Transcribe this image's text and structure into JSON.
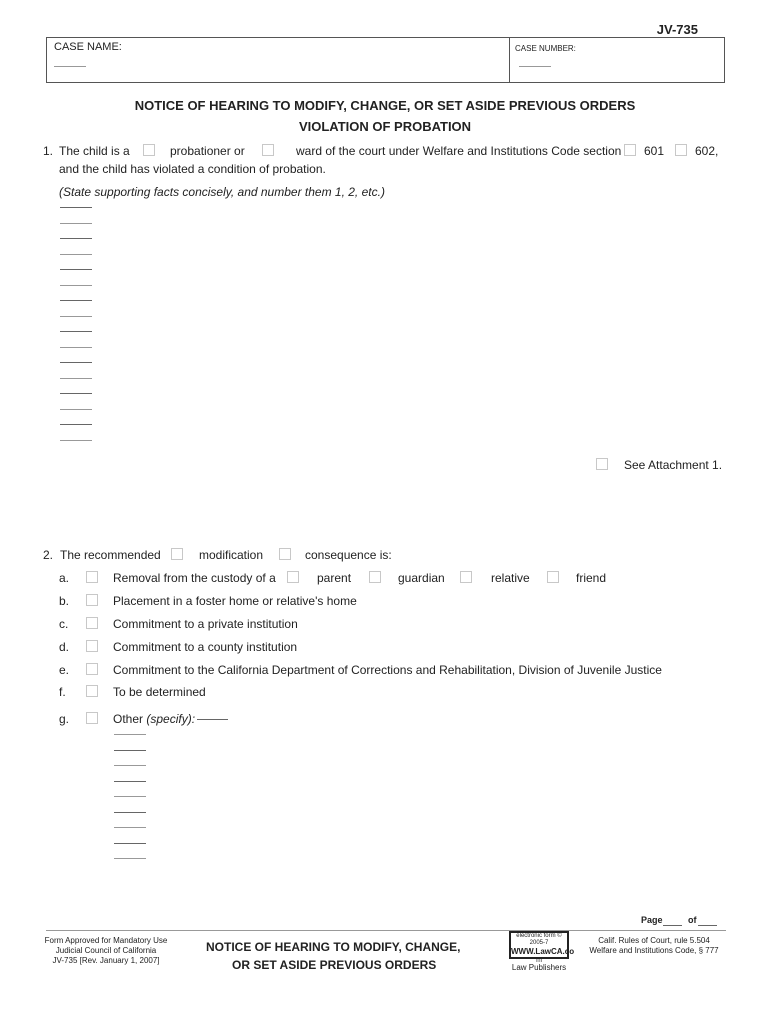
{
  "form_number": "JV-735",
  "case_box": {
    "case_name_label": "CASE NAME:",
    "case_name_value": "",
    "case_number_label": "CASE NUMBER:",
    "case_number_value": ""
  },
  "title": {
    "line1": "NOTICE OF HEARING TO MODIFY, CHANGE, OR SET ASIDE PREVIOUS ORDERS",
    "line2": "VIOLATION OF PROBATION"
  },
  "section1": {
    "number": "1.",
    "text_a": "The child is a",
    "opt_probationer": "probationer or",
    "opt_ward": "ward of the court under Welfare and Institutions Code section",
    "opt_601": "601",
    "opt_602": "602,",
    "line2": "and the child has violated a condition of probation.",
    "instruction": "(State supporting facts concisely, and number them 1, 2, etc.)",
    "fact_lines": [
      "",
      "",
      "",
      "",
      "",
      "",
      "",
      "",
      "",
      "",
      "",
      "",
      "",
      "",
      "",
      ""
    ],
    "see_attachment": "See Attachment 1."
  },
  "section2": {
    "number": "2.",
    "text_a": "The recommended",
    "opt_modification": "modification",
    "opt_consequence": "consequence is:",
    "items": [
      {
        "letter": "a.",
        "text": "Removal from the custody of a"
      },
      {
        "letter": "b.",
        "text": "Placement in a foster home or relative's home"
      },
      {
        "letter": "c.",
        "text": "Commitment to a private institution"
      },
      {
        "letter": "d.",
        "text": "Commitment to a county institution"
      },
      {
        "letter": "e.",
        "text": "Commitment to the California Department of Corrections and Rehabilitation, Division of Juvenile Justice"
      },
      {
        "letter": "f.",
        "text": "To be determined"
      },
      {
        "letter": "g.",
        "text": "Other",
        "specify": "(specify):"
      }
    ],
    "custody_options": [
      "parent",
      "guardian",
      "relative",
      "friend"
    ],
    "other_lines": [
      "",
      "",
      "",
      "",
      "",
      "",
      "",
      "",
      ""
    ]
  },
  "footer": {
    "page_label": "Page",
    "of_label": "of",
    "left_lines": [
      "Form Approved for Mandatory Use",
      "Judicial Council of California",
      "JV-735 [Rev. January 1, 2007]"
    ],
    "center_line1": "NOTICE OF HEARING TO MODIFY, CHANGE,",
    "center_line2": "OR SET ASIDE PREVIOUS ORDERS",
    "stamp_line1": "electronic form ©",
    "stamp_line2": "2005-7",
    "stamp_url": "WWW.LawCA.co",
    "stamp_overflow": "m",
    "stamp_publisher": "Law Publishers",
    "right_lines": [
      "Calif. Rules of Court, rule 5.504",
      "Welfare and Institutions Code, § 777"
    ]
  }
}
